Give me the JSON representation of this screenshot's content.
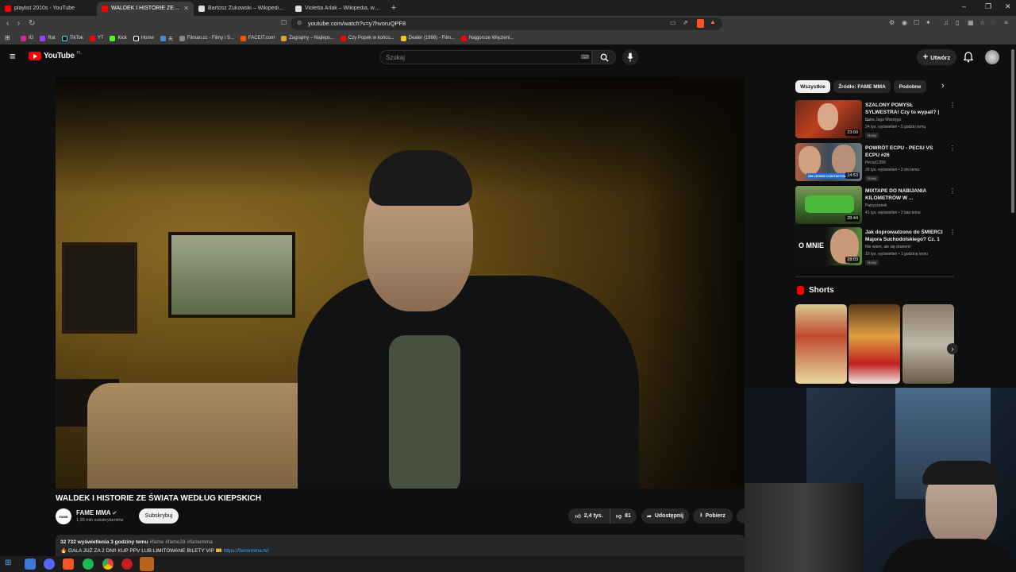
{
  "browser": {
    "tabs": [
      {
        "label": "playlist 2010s - YouTube"
      },
      {
        "label": "WALDEK I HISTORIE ZE ŚWIAT"
      },
      {
        "label": "Bartosz Żukowski – Wikipedia, wolna"
      },
      {
        "label": "Violetta Arlak – Wikipedia, wolna enc"
      }
    ],
    "url": "youtube.com/watch?v=y7hvoruQPF8",
    "bookmarks": [
      "IG",
      "Rat",
      "TikTok",
      "YT",
      "Kick",
      "Home",
      "天",
      "Filman.cc - Filmy i S...",
      "FACEIT.com",
      "Zagrajmy – Najleps...",
      "Czy Popek w końcu...",
      "Dealer (1996) - Film...",
      "Najgorsze Więzieni..."
    ]
  },
  "yt": {
    "logo": "YouTube",
    "region": "PL",
    "search_placeholder": "Szukaj",
    "create_label": "Utwórz"
  },
  "video": {
    "title": "WALDEK I HISTORIE ZE ŚWIATA WEDŁUG KIEPSKICH",
    "channel": "FAME MMA",
    "channel_logo_text": "FAME",
    "subscribers": "1,36 mln subskrybentów",
    "subscribe_label": "Subskrybuj",
    "likes": "2,4 tys.",
    "dislikes": "81",
    "share_label": "Udostępnij",
    "download_label": "Pobierz",
    "desc_stats": "32 732 wyświetlenia  3 godziny temu",
    "desc_tags": "#fame #fame28 #famemma",
    "desc_line2": "🔥 GALA JUŻ ZA 2 DNI! KUP PPV LUB LIMITOWANE BILETY VIP 🎫",
    "desc_link": "https://famemma.tv/"
  },
  "sidebar": {
    "chips": [
      "Wszystkie",
      "Źródło: FAME MMA",
      "Podobne"
    ],
    "recommendations": [
      {
        "title": "SZALONY POMYSŁ SYLWESTRA! Czy to wypali? | ...",
        "channel": "Baba Jaga Warzęga",
        "meta": "24 tys. wyświetleń • 5 godzin temu",
        "badge": "Nowy",
        "duration": "23:00"
      },
      {
        "title": "POWRÓT ECPU - PECIU VS ECPU #26",
        "channel": "PeciuCJDR",
        "meta": "26 tys. wyświetleń • 2 dni temu",
        "badge": "Nowy",
        "duration": "14:53",
        "thumb_label": "ON LEDWO KONTAKTOWAŁ"
      },
      {
        "title": "MIXTAPE DO NABIJANIA KILOMETRÓW W ...",
        "channel": "Patryczeeek",
        "meta": "41 tys. wyświetleń • 2 lata temu",
        "badge": "",
        "duration": "28:44"
      },
      {
        "title": "Jak doprowadzono do ŚMIERCI Majora Suchodolskiego? Cz. 1",
        "channel": "Nie wiem, ale się dowiem!",
        "meta": "10 tys. wyświetleń • 1 godzinę temu",
        "badge": "Nowy",
        "duration": "28:03",
        "thumb_label": "O MNIE"
      }
    ],
    "shorts_title": "Shorts"
  },
  "colors": {
    "yt_red": "#ff0000",
    "link": "#3ea6ff",
    "bg": "#0f0f0f"
  }
}
